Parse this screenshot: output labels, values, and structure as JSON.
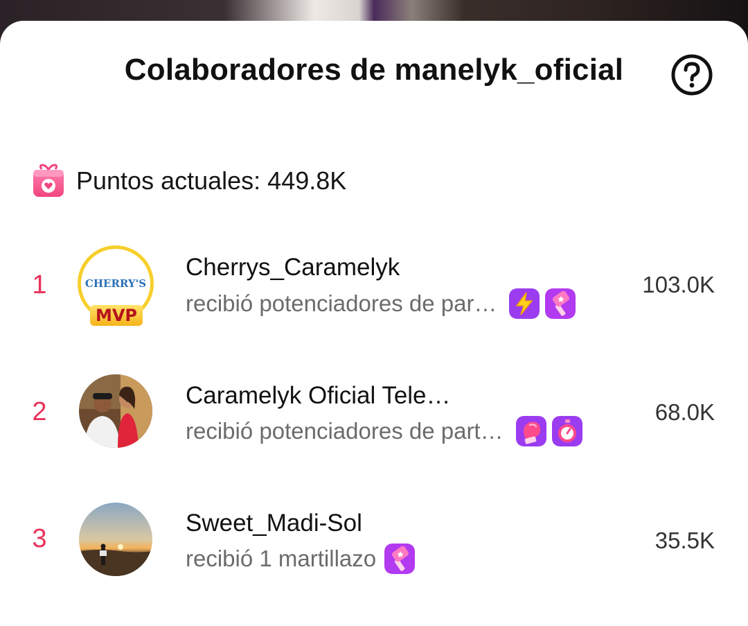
{
  "header": {
    "title": "Colaboradores de manelyk_oficial"
  },
  "points": {
    "label": "Puntos actuales: 449.8K"
  },
  "contributors": [
    {
      "rank": "1",
      "name": "Cherrys_Caramelyk",
      "subtitle": "recibió potenciadores de par…",
      "score": "103.0K",
      "avatar_text": "CHERRY'S",
      "mvp_label": "MVP",
      "badges": [
        "lightning-boost-icon",
        "hammer-icon"
      ]
    },
    {
      "rank": "2",
      "name": "Caramelyk Oficial Tele…",
      "subtitle": "recibió potenciadores de part…",
      "score": "68.0K",
      "badges": [
        "boxing-glove-icon",
        "stopwatch-icon"
      ]
    },
    {
      "rank": "3",
      "name": "Sweet_Madi-Sol",
      "subtitle": "recibió 1 martillazo",
      "score": "35.5K",
      "badges": [
        "hammer-icon"
      ]
    }
  ],
  "colors": {
    "rank": "#e8325a",
    "badge_purple": "#9b3cf0",
    "mvp_ring": "#f7cf2b"
  }
}
